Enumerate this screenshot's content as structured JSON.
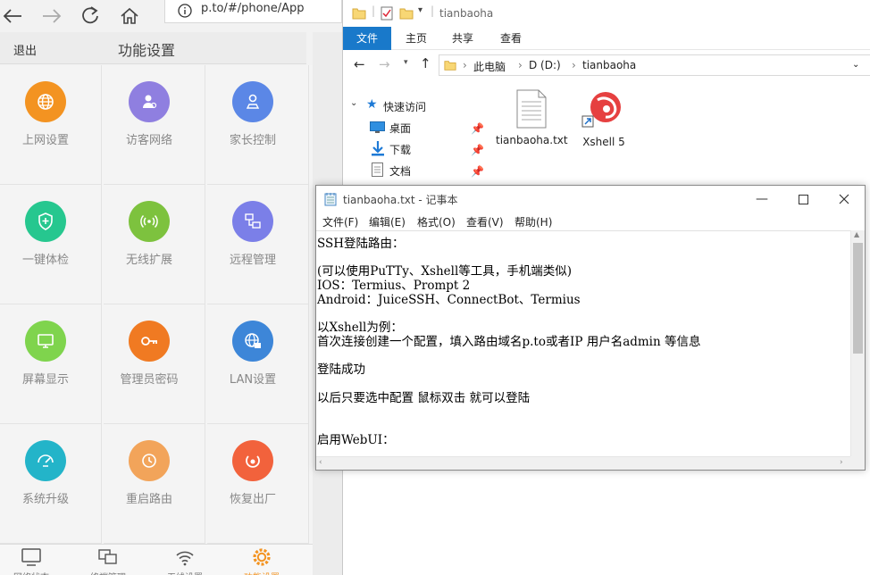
{
  "browser": {
    "url": "p.to/#/phone/App",
    "app": {
      "back_label": "退出",
      "title": "功能设置",
      "grid": [
        {
          "label": "上网设置",
          "icon": "globe-icon",
          "color": "#f39321"
        },
        {
          "label": "访客网络",
          "icon": "guest-user-icon",
          "color": "#8f7fe0"
        },
        {
          "label": "家长控制",
          "icon": "parent-control-icon",
          "color": "#5b87e6"
        },
        {
          "label": "一键体检",
          "icon": "shield-check-icon",
          "color": "#26c78f"
        },
        {
          "label": "无线扩展",
          "icon": "wireless-extend-icon",
          "color": "#7dc23e"
        },
        {
          "label": "远程管理",
          "icon": "remote-manage-icon",
          "color": "#7b7fe8"
        },
        {
          "label": "屏幕显示",
          "icon": "screen-display-icon",
          "color": "#7fd44d"
        },
        {
          "label": "管理员密码",
          "icon": "admin-key-icon",
          "color": "#f07a22"
        },
        {
          "label": "LAN设置",
          "icon": "lan-globe-icon",
          "color": "#3d86d8"
        },
        {
          "label": "系统升级",
          "icon": "system-upgrade-icon",
          "color": "#23b4c9"
        },
        {
          "label": "重启路由",
          "icon": "reboot-icon",
          "color": "#f2a45a"
        },
        {
          "label": "恢复出厂",
          "icon": "factory-reset-icon",
          "color": "#f2623c"
        }
      ],
      "tabs": [
        {
          "label": "网络状态",
          "icon": "monitor-icon"
        },
        {
          "label": "终端管理",
          "icon": "devices-icon"
        },
        {
          "label": "无线设置",
          "icon": "wifi-icon"
        },
        {
          "label": "功能设置",
          "icon": "gear-icon",
          "active": true
        }
      ],
      "accent": "#f39321"
    }
  },
  "explorer": {
    "title": "tianbaoha",
    "ribbon": [
      "文件",
      "主页",
      "共享",
      "查看"
    ],
    "path": [
      "此电脑",
      "D (D:)",
      "tianbaoha"
    ],
    "nav": [
      {
        "label": "快速访问",
        "icon": "star-icon"
      },
      {
        "label": "桌面",
        "icon": "desktop-icon"
      },
      {
        "label": "下载",
        "icon": "download-icon"
      },
      {
        "label": "文档",
        "icon": "document-icon"
      }
    ],
    "files": [
      {
        "name": "tianbaoha.txt",
        "icon": "text-file-icon"
      },
      {
        "name": "Xshell 5",
        "icon": "xshell-icon"
      }
    ]
  },
  "notepad": {
    "title": "tianbaoha.txt - 记事本",
    "menu": [
      "文件(F)",
      "编辑(E)",
      "格式(O)",
      "查看(V)",
      "帮助(H)"
    ],
    "lines": [
      "SSH登陆路由：",
      "",
      "(可以使用PuTTy、Xshell等工具，手机端类似)",
      "IOS：Termius、Prompt 2",
      "Android：JuiceSSH、ConnectBot、Termius",
      "",
      "以Xshell为例：",
      "首次连接创建一个配置，填入路由域名p.to或者IP 用户名admin 等信息",
      "",
      "登陆成功",
      "",
      "以后只要选中配置 鼠标双击 就可以登陆",
      "",
      "",
      "启用WebUI："
    ]
  }
}
